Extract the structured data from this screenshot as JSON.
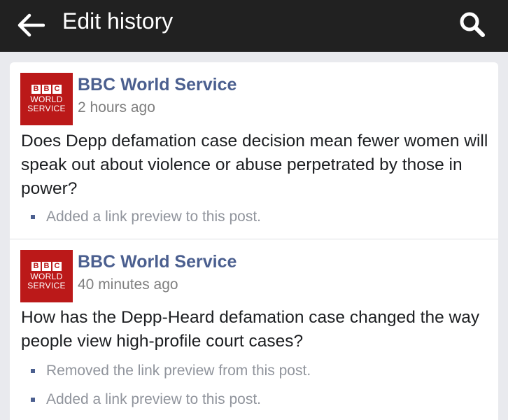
{
  "header": {
    "title": "Edit history",
    "back_icon": "arrow-left-icon",
    "search_icon": "search-icon"
  },
  "colors": {
    "topbar": "#212121",
    "page_name": "#4b5f8f",
    "bbc_red": "#bb1919",
    "muted": "#90949c"
  },
  "posts": [
    {
      "page_name": "BBC World Service",
      "logo": {
        "blocks": [
          "B",
          "B",
          "C"
        ],
        "line1": "WORLD",
        "line2": "SERVICE"
      },
      "time": "2 hours ago",
      "text": "Does Depp defamation case decision mean fewer women will speak out about violence or abuse perpetrated by those in power?",
      "edits": [
        "Added a link preview to this post."
      ]
    },
    {
      "page_name": "BBC World Service",
      "logo": {
        "blocks": [
          "B",
          "B",
          "C"
        ],
        "line1": "WORLD",
        "line2": "SERVICE"
      },
      "time": "40 minutes ago",
      "text": "How has the Depp-Heard defamation case changed the way people view high-profile court cases?",
      "edits": [
        "Removed the link preview from this post.",
        "Added a link preview to this post."
      ]
    }
  ]
}
